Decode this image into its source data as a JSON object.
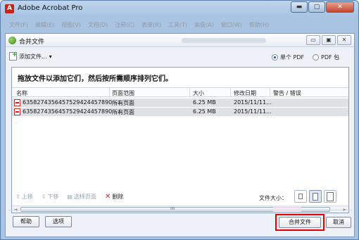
{
  "app": {
    "title": "Adobe Acrobat Pro",
    "logo_glyph": "A"
  },
  "window_controls": {
    "minimize": "▬",
    "maximize": "▢",
    "close": "✕"
  },
  "menubar": [
    "文件(F)",
    "编辑(E)",
    "视图(V)",
    "文档(D)",
    "注释(C)",
    "表单(R)",
    "工具(T)",
    "高级(A)",
    "窗口(W)",
    "帮助(H)"
  ],
  "dialog": {
    "title": "合并文件",
    "controls": {
      "minimize": "▭",
      "restore": "▣",
      "close": "✕"
    },
    "toolbar": {
      "add_files": "添加文件...",
      "add_files_caret": "▾",
      "options": [
        {
          "label": "单个 PDF",
          "selected": true
        },
        {
          "label": "PDF 包",
          "selected": false
        }
      ]
    },
    "hint": "拖放文件以添加它们，然后按所需顺序排列它们。",
    "columns": [
      "名称",
      "页面范围",
      "大小",
      "修改日期",
      "警告 / 错误"
    ],
    "rows": [
      {
        "name": "635827435645752942445789​0 ...",
        "range": "所有页面",
        "size": "6.25 MB",
        "date": "2015/11/11...",
        "warning": ""
      },
      {
        "name": "635827435645752942445789​0 ...",
        "range": "所有页面",
        "size": "6.25 MB",
        "date": "2015/11/11...",
        "warning": ""
      }
    ],
    "scroll": {
      "left": "◄",
      "right": "►",
      "grip": "III"
    },
    "actions": {
      "move_up": "上移",
      "move_down": "下移",
      "choose_pages": "选择页面",
      "delete": "删除"
    },
    "file_size_label": "文件大小：",
    "buttons": {
      "help": "帮助",
      "options": "选项",
      "merge": "合并文件",
      "cancel": "取消"
    }
  },
  "colors": {
    "accent": "#1a4f8f",
    "highlight": "#e00000",
    "delete": "#d12a1a"
  }
}
